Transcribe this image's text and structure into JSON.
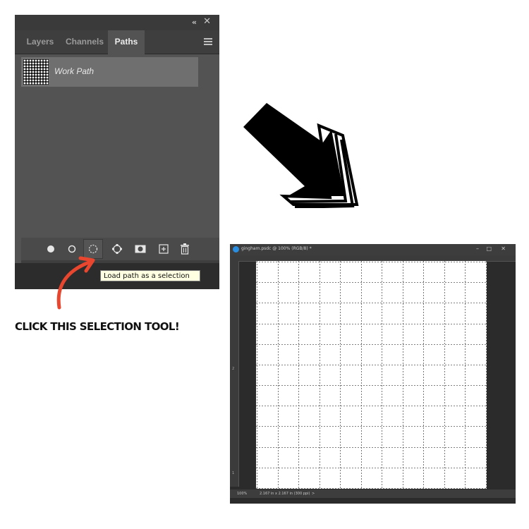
{
  "panel": {
    "collapse_icon": "double-chevron-left-icon",
    "close_icon": "close-icon",
    "tabs": [
      {
        "label": "Layers",
        "active": false
      },
      {
        "label": "Channels",
        "active": false
      },
      {
        "label": "Paths",
        "active": true
      }
    ],
    "menu_icon": "hamburger-icon",
    "paths": [
      {
        "label": "Work Path",
        "selected": true
      }
    ],
    "bottom_tools": [
      {
        "name": "fill-path-icon"
      },
      {
        "name": "stroke-path-icon"
      },
      {
        "name": "load-path-as-selection-icon"
      },
      {
        "name": "make-work-path-icon"
      },
      {
        "name": "add-mask-icon"
      },
      {
        "name": "new-path-icon"
      },
      {
        "name": "delete-path-icon"
      }
    ],
    "tooltip": "Load path as a selection"
  },
  "annotation": {
    "text": "CLICK THIS SELECTION TOOL!",
    "arrow_color": "#e8462e"
  },
  "document": {
    "title": "gingham.psdc @ 100% (RGB/8) *",
    "window_controls": [
      "–",
      "□",
      "✕"
    ],
    "ruler_marks": [
      "2",
      "1"
    ],
    "zoom": "100%",
    "doc_info": "2.167 in x 2.167 in (300 ppi)",
    "status_arrow": ">"
  },
  "colors": {
    "panel_bg": "#535353",
    "tab_bar": "#3e3e3e",
    "selected_row": "#6f6f6f",
    "accent_blue": "#2a8ee0",
    "tooltip_bg": "#ffffe1"
  }
}
